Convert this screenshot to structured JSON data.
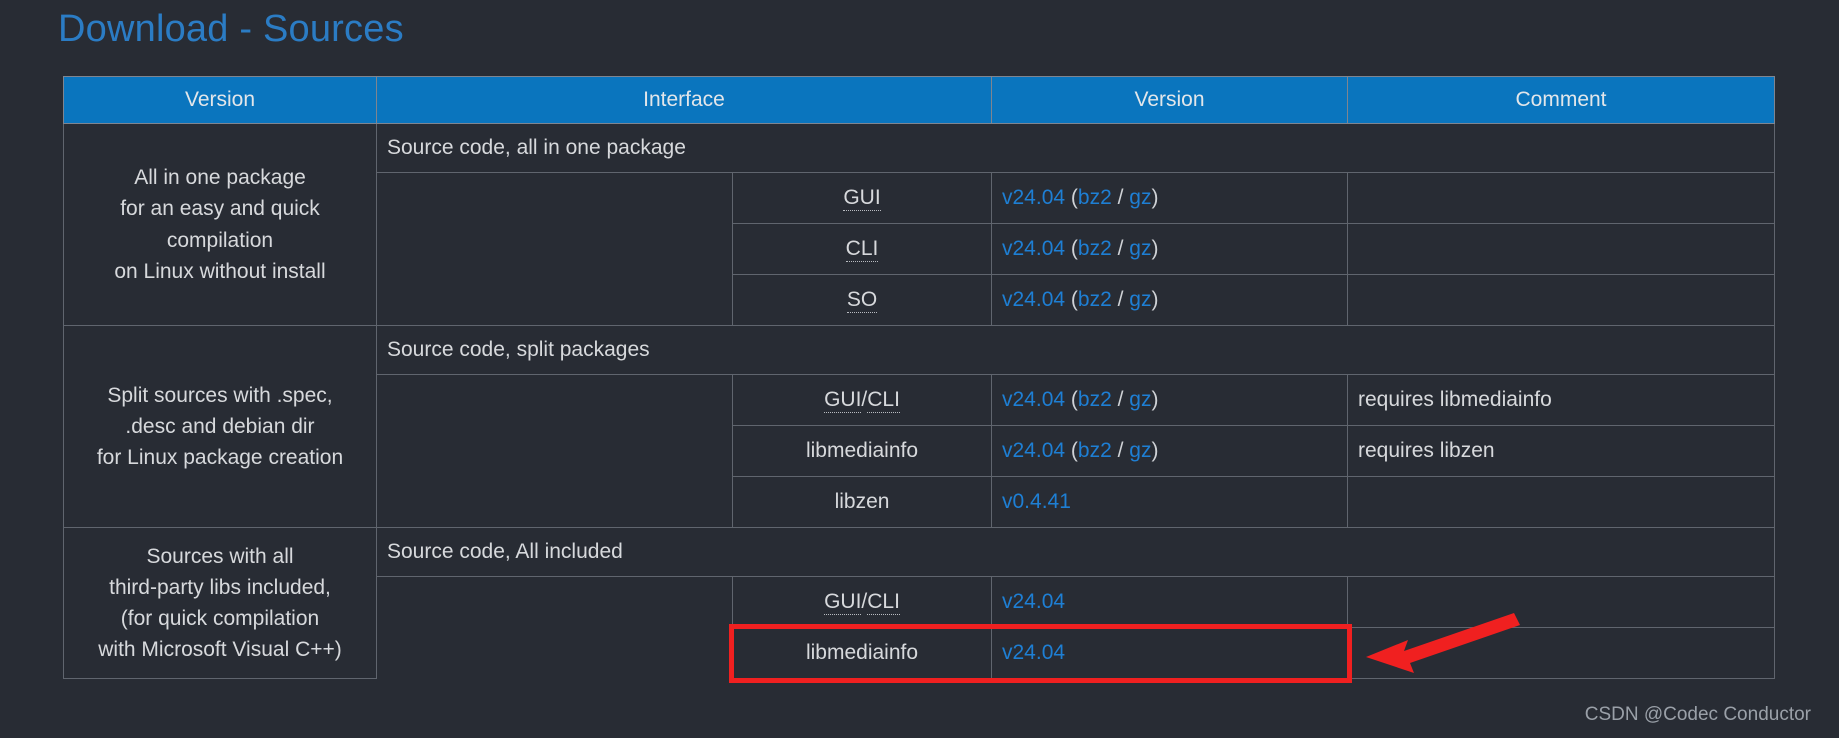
{
  "page": {
    "title": "Download - Sources",
    "background_color": "#282c34",
    "title_color": "#2b7cc4",
    "header_color": "#0a75be",
    "link_color": "#1e7fd4",
    "annotation_color": "#f02020"
  },
  "table": {
    "headers": {
      "version": "Version",
      "interface": "Interface",
      "blank": "",
      "version2": "Version",
      "comment": "Comment"
    },
    "sections": [
      {
        "description_lines": [
          "All in one package",
          "for an easy and quick compilation",
          "on Linux without install"
        ],
        "section_title": "Source code, all in one package",
        "rows": [
          {
            "interface": "GUI",
            "abbr": true,
            "version": "v24.04",
            "formats": [
              "bz2",
              "gz"
            ],
            "comment": ""
          },
          {
            "interface": "CLI",
            "abbr": true,
            "version": "v24.04",
            "formats": [
              "bz2",
              "gz"
            ],
            "comment": ""
          },
          {
            "interface": "SO",
            "abbr": true,
            "version": "v24.04",
            "formats": [
              "bz2",
              "gz"
            ],
            "comment": ""
          }
        ]
      },
      {
        "description_lines": [
          "Split sources with .spec,",
          ".desc and debian dir",
          "for Linux package creation"
        ],
        "section_title": "Source code, split packages",
        "rows": [
          {
            "interface": "GUI/CLI",
            "abbr": true,
            "version": "v24.04",
            "formats": [
              "bz2",
              "gz"
            ],
            "comment": "requires libmediainfo"
          },
          {
            "interface": "libmediainfo",
            "abbr": false,
            "version": "v24.04",
            "formats": [
              "bz2",
              "gz"
            ],
            "comment": "requires libzen"
          },
          {
            "interface": "libzen",
            "abbr": false,
            "version": "v0.4.41",
            "formats": [],
            "comment": ""
          }
        ]
      },
      {
        "description_lines": [
          "Sources with all",
          "third-party libs included,",
          "(for quick compilation",
          "with Microsoft Visual C++)"
        ],
        "section_title": "Source code, All included",
        "rows": [
          {
            "interface": "GUI/CLI",
            "abbr": true,
            "version": "v24.04",
            "formats": [],
            "comment": ""
          },
          {
            "interface": "libmediainfo",
            "abbr": false,
            "version": "v24.04",
            "formats": [],
            "comment": "",
            "highlighted": true
          }
        ]
      }
    ]
  },
  "annotation": {
    "type": "red-rectangle-with-arrow",
    "target": "libmediainfo v24.04"
  },
  "watermark": {
    "text": "CSDN @Codec Conductor"
  }
}
